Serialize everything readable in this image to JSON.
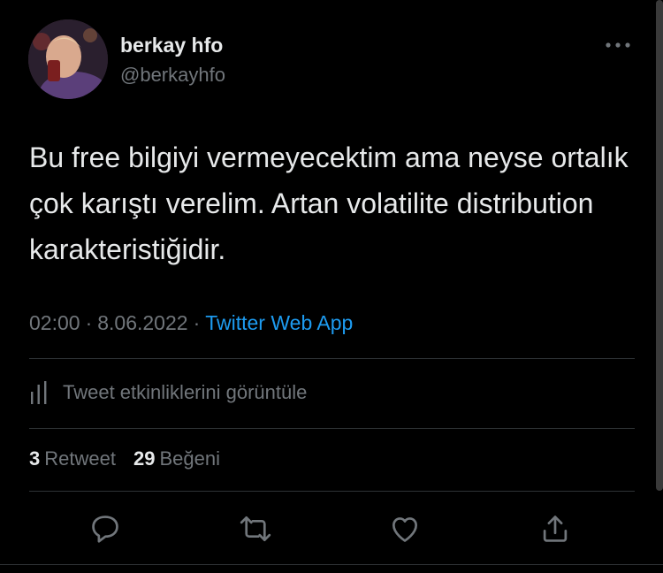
{
  "author": {
    "name": "berkay hfo",
    "handle": "@berkayhfo"
  },
  "tweet": {
    "text": "Bu free bilgiyi vermeyecektim ama neyse ortalık çok karıştı verelim. Artan volatilite distribution karakteristiğidir.",
    "time": "02:00",
    "date": "8.06.2022",
    "separator": "·",
    "source": "Twitter Web App"
  },
  "activity": {
    "label": "Tweet etkinliklerini görüntüle",
    "icon": "analytics-icon"
  },
  "stats": {
    "retweets_count": "3",
    "retweets_label": "Retweet",
    "likes_count": "29",
    "likes_label": "Beğeni"
  },
  "actions": [
    {
      "name": "reply",
      "icon": "reply-icon"
    },
    {
      "name": "retweet",
      "icon": "retweet-icon"
    },
    {
      "name": "like",
      "icon": "heart-icon"
    },
    {
      "name": "share",
      "icon": "share-icon"
    }
  ],
  "colors": {
    "background": "#000000",
    "text": "#e7e9ea",
    "muted": "#71767b",
    "link": "#1d9bf0",
    "divider": "#2f3336"
  }
}
